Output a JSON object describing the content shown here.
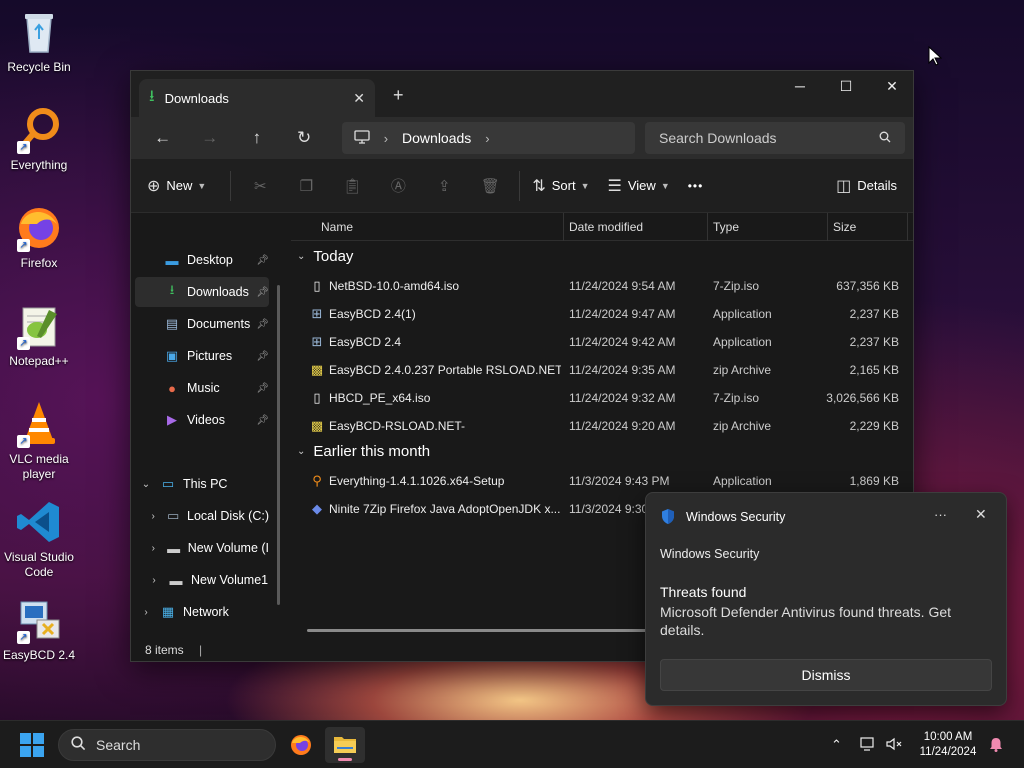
{
  "desktop": {
    "icons": [
      {
        "label": "Recycle Bin",
        "icon": "recycle-bin-icon"
      },
      {
        "label": "Everything",
        "icon": "everything-icon"
      },
      {
        "label": "Firefox",
        "icon": "firefox-icon"
      },
      {
        "label": "Notepad++",
        "icon": "notepadpp-icon"
      },
      {
        "label": "VLC media player",
        "icon": "vlc-icon"
      },
      {
        "label": "Visual Studio Code",
        "icon": "vscode-icon"
      },
      {
        "label": "EasyBCD 2.4",
        "icon": "easybcd-icon"
      }
    ]
  },
  "explorer": {
    "tab_title": "Downloads",
    "new_tab": "+",
    "address": {
      "location": "Downloads"
    },
    "search_placeholder": "Search Downloads",
    "commands": {
      "new": "New",
      "sort": "Sort",
      "view": "View",
      "more": "•••",
      "details": "Details"
    },
    "nav": {
      "quick_access": [
        {
          "label": "Desktop",
          "icon": "desktop-icon"
        },
        {
          "label": "Downloads",
          "icon": "download-icon",
          "selected": true
        },
        {
          "label": "Documents",
          "icon": "documents-icon"
        },
        {
          "label": "Pictures",
          "icon": "pictures-icon"
        },
        {
          "label": "Music",
          "icon": "music-icon"
        },
        {
          "label": "Videos",
          "icon": "videos-icon"
        }
      ],
      "this_pc": "This PC",
      "drives": [
        "Local Disk (C:)",
        "New Volume (I",
        "New Volume1"
      ],
      "network": "Network"
    },
    "columns": {
      "name": "Name",
      "date": "Date modified",
      "type": "Type",
      "size": "Size"
    },
    "groups": [
      {
        "label": "Today",
        "files": [
          {
            "name": "NetBSD-10.0-amd64.iso",
            "date": "11/24/2024 9:54 AM",
            "type": "7-Zip.iso",
            "size": "637,356 KB",
            "icon": "iso-file-icon"
          },
          {
            "name": "EasyBCD 2.4(1)",
            "date": "11/24/2024 9:47 AM",
            "type": "Application",
            "size": "2,237 KB",
            "icon": "easybcd-app-icon"
          },
          {
            "name": "EasyBCD 2.4",
            "date": "11/24/2024 9:42 AM",
            "type": "Application",
            "size": "2,237 KB",
            "icon": "easybcd-app-icon"
          },
          {
            "name": "EasyBCD 2.4.0.237 Portable RSLOAD.NET",
            "date": "11/24/2024 9:35 AM",
            "type": "zip Archive",
            "size": "2,165 KB",
            "icon": "zip-archive-icon"
          },
          {
            "name": "HBCD_PE_x64.iso",
            "date": "11/24/2024 9:32 AM",
            "type": "7-Zip.iso",
            "size": "3,026,566 KB",
            "icon": "iso-file-icon"
          },
          {
            "name": "EasyBCD-RSLOAD.NET-",
            "date": "11/24/2024 9:20 AM",
            "type": "zip Archive",
            "size": "2,229 KB",
            "icon": "zip-archive-icon"
          }
        ]
      },
      {
        "label": "Earlier this month",
        "files": [
          {
            "name": "Everything-1.4.1.1026.x64-Setup",
            "date": "11/3/2024 9:43 PM",
            "type": "Application",
            "size": "1,869 KB",
            "icon": "everything-setup-icon"
          },
          {
            "name": "Ninite 7Zip Firefox Java AdoptOpenJDK x...",
            "date": "11/3/2024 9:30",
            "type": "",
            "size": "",
            "icon": "ninite-icon"
          }
        ]
      }
    ],
    "status": "8 items"
  },
  "notification": {
    "app": "Windows Security",
    "source": "Windows Security",
    "title": "Threats found",
    "body": "Microsoft Defender Antivirus found threats. Get details.",
    "more": "···",
    "dismiss": "Dismiss"
  },
  "taskbar": {
    "search_label": "Search",
    "time": "10:00 AM",
    "date": "11/24/2024"
  },
  "colors": {
    "accent": "#3ba4f0",
    "folder": "#e8b83a",
    "download_green": "#3fbf5f",
    "shield_blue": "#2f7fe0"
  }
}
